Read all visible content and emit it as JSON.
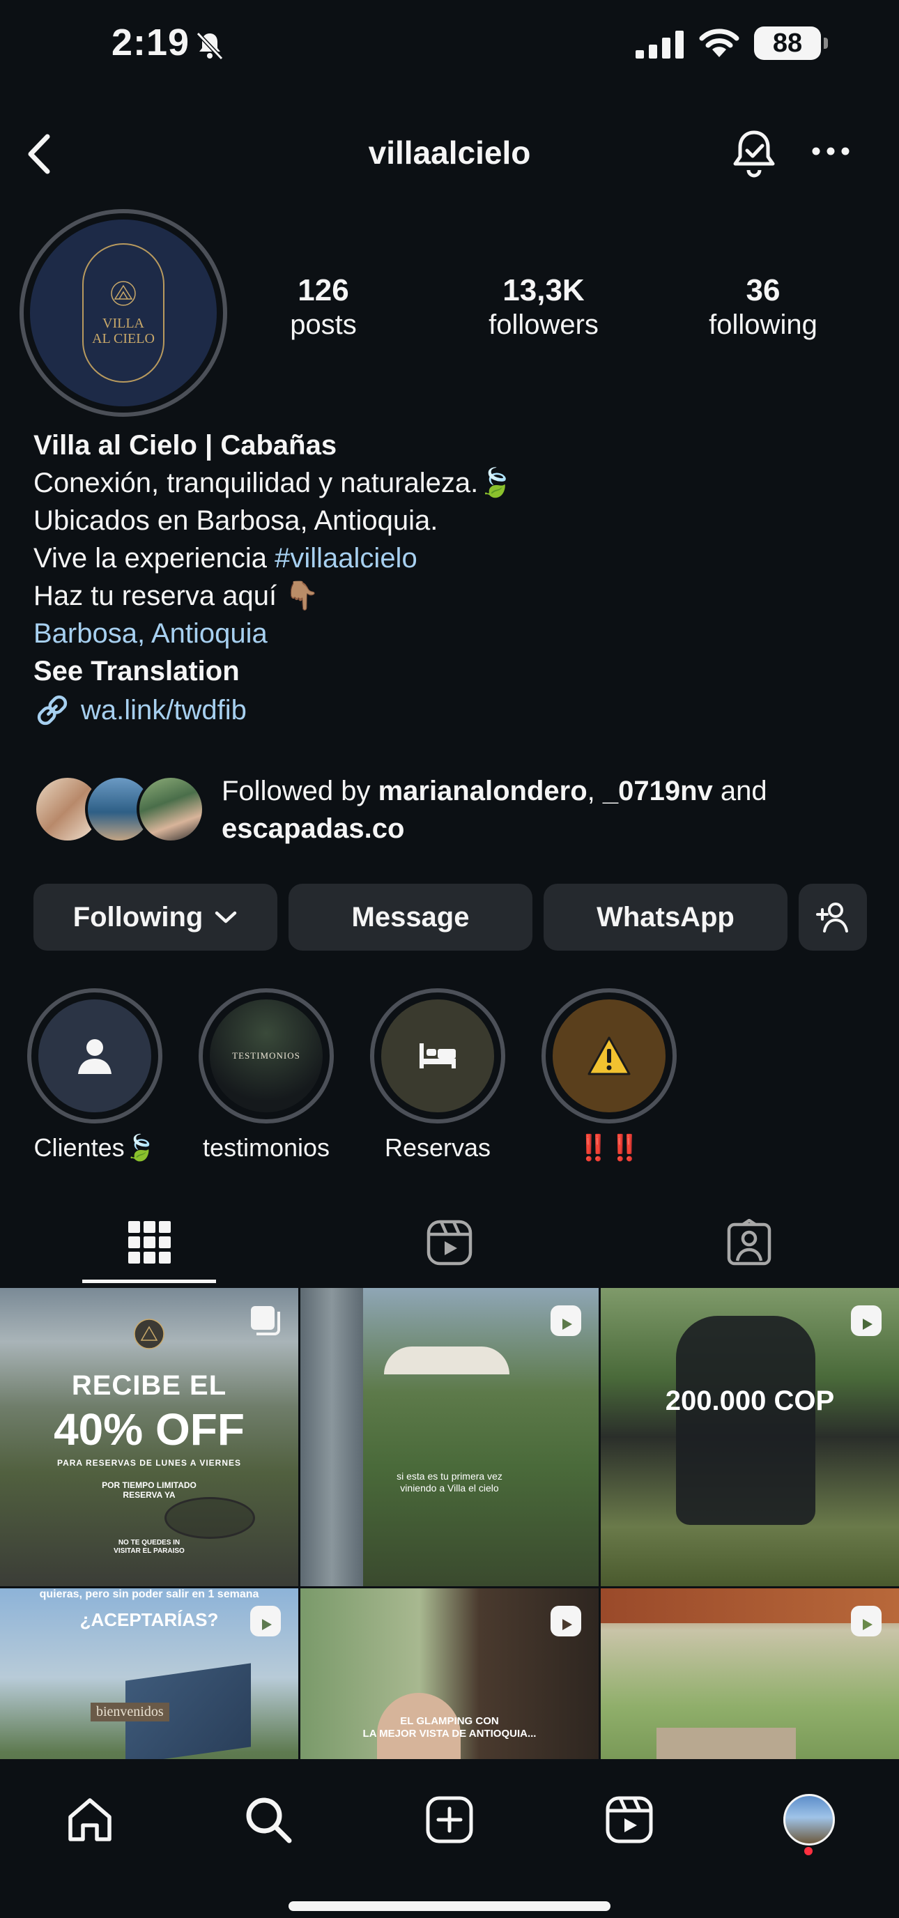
{
  "status_bar": {
    "time": "2:19",
    "battery": "88"
  },
  "header": {
    "username": "villaalcielo"
  },
  "profile": {
    "avatar_logo_text": "VILLA\nAL CIELO",
    "stats": [
      {
        "value": "126",
        "label": "posts"
      },
      {
        "value": "13,3K",
        "label": "followers"
      },
      {
        "value": "36",
        "label": "following"
      }
    ],
    "bio": {
      "name": "Villa al Cielo | Cabañas",
      "line1": "Conexión, tranquilidad y naturaleza.🍃",
      "line2": "Ubicados en Barbosa, Antioquia.",
      "line3_prefix": "Vive la experiencia ",
      "line3_hashtag": "#villaalcielo",
      "line4": "Haz tu reserva aquí 👇🏽",
      "location": "Barbosa, Antioquia",
      "see_translation": "See Translation",
      "link": "wa.link/twdfib"
    },
    "followed_by": {
      "prefix": "Followed by ",
      "user1": "marianalondero",
      "sep": ", ",
      "user2": "_0719nv",
      "and": " and",
      "user3": "escapadas.co"
    }
  },
  "buttons": {
    "following": "Following",
    "message": "Message",
    "whatsapp": "WhatsApp"
  },
  "highlights": [
    {
      "label": "Clientes🍃"
    },
    {
      "label": "testimonios",
      "cover_text": "TESTIMONIOS"
    },
    {
      "label": "Reservas"
    },
    {
      "label": "‼️‼️"
    }
  ],
  "grid": {
    "post1": {
      "headline": "RECIBE EL",
      "big": "40% OFF",
      "sub": "PARA RESERVAS DE LUNES A VIERNES",
      "sub2": "POR TIEMPO LIMITADO\nRESERVA YA",
      "sub3": "NO TE QUEDES IN\nVISITAR EL PARAISO"
    },
    "post2": {
      "caption": "si esta es tu primera vez\nviniendo a Villa el cielo"
    },
    "post3": {
      "big": "200.000 COP"
    },
    "post4": {
      "top": "quieras, pero sin poder salir en 1 semana",
      "big": "¿ACEPTARÍAS?",
      "sign": "bienvenidos"
    },
    "post5": {
      "caption": "EL GLAMPING CON\nLA MEJOR VISTA DE ANTIOQUIA..."
    },
    "post6": {}
  },
  "colors": {
    "background": "#0c1014",
    "link": "#a7d0f0",
    "button": "#25292e",
    "badge": "#ff3040"
  }
}
